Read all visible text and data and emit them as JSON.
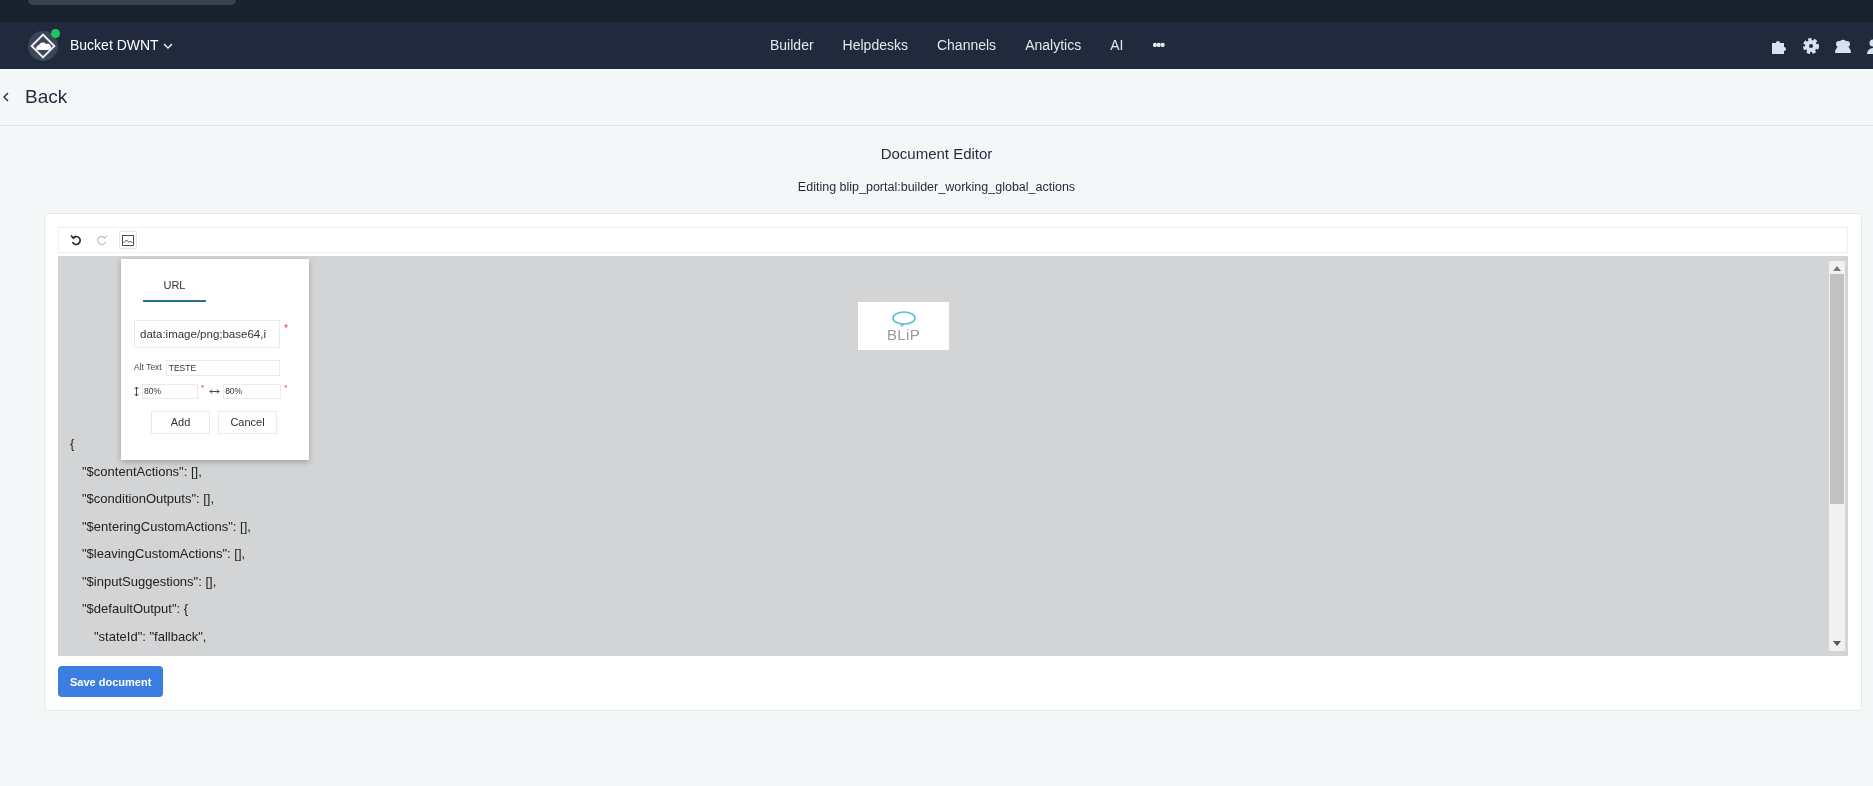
{
  "app_bar": {
    "workspace": "Bucket DWNT",
    "online": true,
    "menu": [
      {
        "label": "Builder"
      },
      {
        "label": "Helpdesks"
      },
      {
        "label": "Channels"
      },
      {
        "label": "Analytics"
      },
      {
        "label": "AI"
      }
    ],
    "more": "•••"
  },
  "back": {
    "label": "Back"
  },
  "page": {
    "title": "Document Editor",
    "subtitle": "Editing blip_portal:builder_working_global_actions"
  },
  "toolbar": [
    {
      "kind": "undo",
      "disabled": false
    },
    {
      "kind": "redo",
      "disabled": true
    },
    {
      "kind": "image",
      "disabled": false
    }
  ],
  "image_dialog": {
    "tabs": [
      {
        "label": "URL",
        "selected": true
      }
    ],
    "url": {
      "value": "data:image/png;base64,i",
      "required_mark": "*"
    },
    "alt": {
      "label": "Alt Text",
      "value": "TESTE"
    },
    "height": {
      "value": "80%",
      "required_mark": "*"
    },
    "width": {
      "value": "80%",
      "required_mark": "*"
    },
    "buttons": [
      {
        "label": "Add"
      },
      {
        "label": "Cancel"
      }
    ]
  },
  "document": {
    "image_text": "BLiP",
    "code": [
      {
        "text": "{",
        "children": [
          {
            "text": "\"$contentActions\": [],"
          },
          {
            "text": "\"$conditionOutputs\": [],"
          },
          {
            "text": "\"$enteringCustomActions\": [],"
          },
          {
            "text": "\"$leavingCustomActions\": [],"
          },
          {
            "text": "\"$inputSuggestions\": [],"
          },
          {
            "text": "\"$defaultOutput\": {",
            "children": [
              {
                "text": "\"stateId\": \"fallback\","
              }
            ]
          }
        ]
      }
    ]
  },
  "save_button": {
    "label": "Save document"
  }
}
